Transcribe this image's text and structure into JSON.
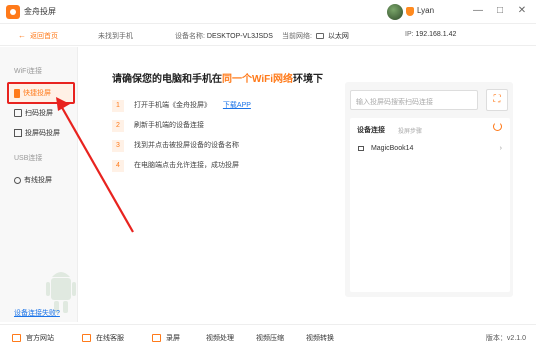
{
  "app": {
    "title": "金舟投屏"
  },
  "user": {
    "name": "Lyan"
  },
  "window_controls": [
    "—",
    "□",
    "✕"
  ],
  "infobar": {
    "back_label": "返回首页",
    "no_phone_label": "未找到手机",
    "device_name_label": "设备名称:",
    "device_name_value": "DESKTOP-VL3JSDS",
    "network_label": "当前网络:",
    "network_value": "以太网",
    "ip_label": "IP:",
    "ip_value": "192.168.1.42"
  },
  "sidebar": {
    "wifi_section": "WiFi连接",
    "items": [
      {
        "label": "快捷投屏",
        "icon": "phone-icon",
        "active": true
      },
      {
        "label": "扫码投屏",
        "icon": "scan-icon",
        "active": false
      },
      {
        "label": "投屏码投屏",
        "icon": "code-icon",
        "active": false
      }
    ],
    "usb_section": "USB连接",
    "usb_item": {
      "label": "有线投屏",
      "icon": "usb-icon"
    },
    "help_link": "设备连接失败?"
  },
  "main": {
    "title_prefix": "请确保您的电脑和手机在",
    "title_accent": "同一个WiFi网络",
    "title_suffix": "环境下",
    "steps": [
      {
        "num": "1",
        "text": "打开手机端《金舟投屏》",
        "link": "下载APP"
      },
      {
        "num": "2",
        "text": "刷新手机端的设备连接",
        "link": ""
      },
      {
        "num": "3",
        "text": "找到并点击被投屏设备的设备名称",
        "link": ""
      },
      {
        "num": "4",
        "text": "在电脑端点击允许连接，成功投屏",
        "link": ""
      }
    ]
  },
  "panel": {
    "search_placeholder": "输入投屏码搜索扫码连接",
    "device_title": "设备连接",
    "device_sub": "投屏步骤",
    "devices": [
      {
        "name": "MagicBook14"
      }
    ]
  },
  "bottombar": {
    "items": [
      "官方网站",
      "在线客服",
      "录屏",
      "视频处理",
      "视频压缩",
      "视频转换"
    ],
    "version": "版本：v2.1.0"
  },
  "colors": {
    "accent": "#ff7a1a",
    "annotation": "#e8231f",
    "link": "#1a73e8"
  }
}
